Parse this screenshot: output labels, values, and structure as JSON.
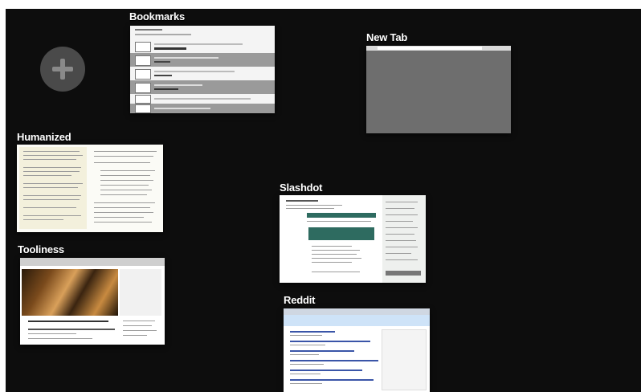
{
  "tabs": [
    {
      "id": "bookmarks",
      "title": "Bookmarks"
    },
    {
      "id": "new-tab",
      "title": "New Tab"
    },
    {
      "id": "humanized",
      "title": "Humanized"
    },
    {
      "id": "slashdot",
      "title": "Slashdot"
    },
    {
      "id": "tooliness",
      "title": "Tooliness"
    },
    {
      "id": "reddit",
      "title": "Reddit"
    }
  ],
  "add_button": {
    "icon": "plus-icon"
  },
  "colors": {
    "background": "#0d0d0d",
    "title_text": "#ffffff",
    "add_button": "#4a4a4a",
    "slashdot_accent": "#2e6b60",
    "reddit_accent": "#cee3f8"
  }
}
